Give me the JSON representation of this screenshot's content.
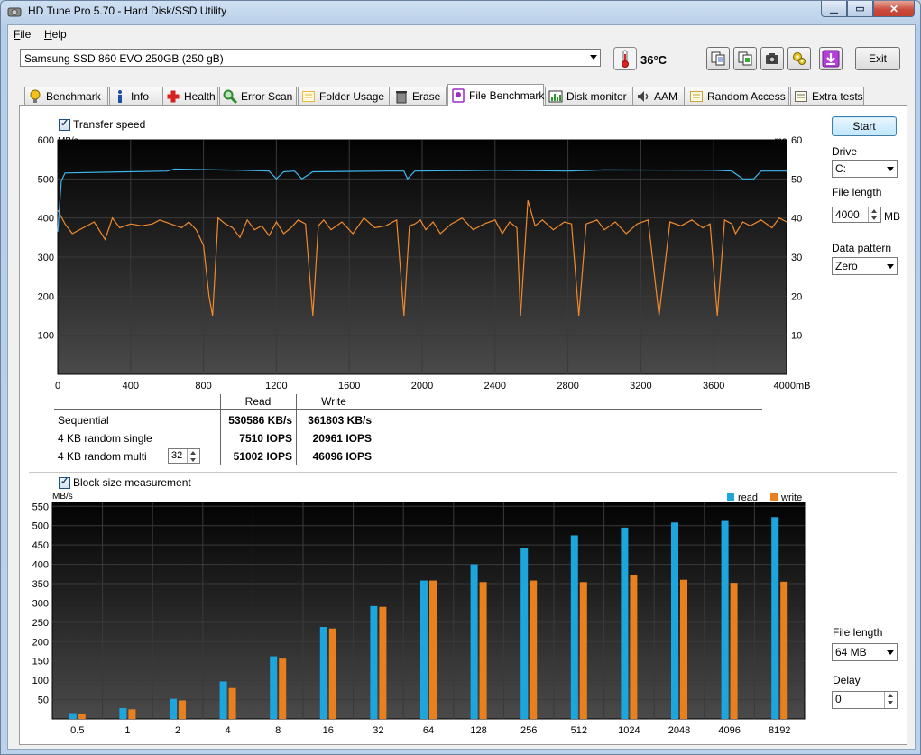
{
  "window": {
    "title": "HD Tune Pro 5.70 - Hard Disk/SSD Utility",
    "buttons": [
      "minimize",
      "maximize",
      "close"
    ]
  },
  "menu": {
    "items": [
      "File",
      "Help"
    ]
  },
  "toolbar": {
    "drive": "Samsung SSD 860 EVO 250GB (250 gB)",
    "temperature": "36°C",
    "exit_label": "Exit",
    "icons": [
      "copy-text-icon",
      "copy-info-icon",
      "screenshot-icon",
      "options-icon",
      "save-icon"
    ]
  },
  "tabs": [
    {
      "label": "Benchmark",
      "icon": "bulb-icon"
    },
    {
      "label": "Info",
      "icon": "info-icon"
    },
    {
      "label": "Health",
      "icon": "health-icon"
    },
    {
      "label": "Error Scan",
      "icon": "magnifier-icon"
    },
    {
      "label": "Folder Usage",
      "icon": "folder-icon"
    },
    {
      "label": "Erase",
      "icon": "trash-icon"
    },
    {
      "label": "File Benchmark",
      "icon": "file-benchmark-icon",
      "active": true
    },
    {
      "label": "Disk monitor",
      "icon": "monitor-icon"
    },
    {
      "label": "AAM",
      "icon": "speaker-icon"
    },
    {
      "label": "Random Access",
      "icon": "random-icon"
    },
    {
      "label": "Extra tests",
      "icon": "extra-icon"
    }
  ],
  "controls": {
    "start_label": "Start",
    "drive_label": "Drive",
    "drive_value": "C:",
    "file_length_label": "File length",
    "file_length_value": "4000",
    "file_length_unit": "MB",
    "data_pattern_label": "Data pattern",
    "data_pattern_value": "Zero",
    "bs_file_length_label": "File length",
    "bs_file_length_value": "64 MB",
    "delay_label": "Delay",
    "delay_value": "0"
  },
  "transfer": {
    "checkbox_label": "Transfer speed",
    "checked": true,
    "y_left_unit": "MB/s",
    "y_right_unit": "ms",
    "x_unit": "mB",
    "y_left_ticks": [
      "600",
      "500",
      "400",
      "300",
      "200",
      "100"
    ],
    "y_right_ticks": [
      "60",
      "50",
      "40",
      "30",
      "20",
      "10"
    ],
    "x_ticks": [
      "0",
      "400",
      "800",
      "1200",
      "1600",
      "2000",
      "2400",
      "2800",
      "3200",
      "3600",
      "4000"
    ]
  },
  "results": {
    "headers": [
      "Read",
      "Write"
    ],
    "rows": [
      {
        "label": "Sequential",
        "read": "530586 KB/s",
        "write": "361803 KB/s"
      },
      {
        "label": "4 KB random single",
        "read": "7510 IOPS",
        "write": "20961 IOPS"
      },
      {
        "label": "4 KB random multi",
        "read": "51002 IOPS",
        "write": "46096 IOPS",
        "queue": "32"
      }
    ]
  },
  "blocksize": {
    "checkbox_label": "Block size measurement",
    "checked": true,
    "y_unit": "MB/s",
    "legend": [
      "read",
      "write"
    ]
  },
  "colors": {
    "read_line": "#3fb6ef",
    "write_line": "#f08a2c",
    "read_bar": "#1da6de",
    "write_bar": "#e8801e"
  },
  "chart_data": [
    {
      "type": "line",
      "title": "",
      "xlabel": "mB",
      "ylabel": "MB/s",
      "xlim": [
        0,
        4000
      ],
      "ylim": [
        0,
        600
      ],
      "y2lim": [
        0,
        60
      ],
      "series": [
        {
          "name": "Read",
          "x": [
            0,
            20,
            40,
            600,
            640,
            1000,
            1160,
            1200,
            1240,
            1300,
            1340,
            1400,
            1800,
            1900,
            1920,
            1960,
            2400,
            2800,
            3000,
            3600,
            3700,
            3760,
            3820,
            3860,
            4000
          ],
          "values": [
            365,
            495,
            515,
            520,
            525,
            522,
            520,
            500,
            518,
            520,
            500,
            518,
            520,
            520,
            500,
            520,
            522,
            520,
            523,
            522,
            520,
            500,
            500,
            520,
            520
          ]
        },
        {
          "name": "Write",
          "x": [
            0,
            40,
            80,
            140,
            200,
            260,
            300,
            340,
            400,
            460,
            520,
            560,
            620,
            680,
            720,
            760,
            800,
            830,
            850,
            880,
            920,
            960,
            1000,
            1040,
            1080,
            1120,
            1160,
            1200,
            1240,
            1280,
            1320,
            1360,
            1400,
            1430,
            1460,
            1500,
            1560,
            1620,
            1680,
            1740,
            1800,
            1860,
            1900,
            1930,
            1960,
            1990,
            2020,
            2060,
            2100,
            2160,
            2220,
            2280,
            2340,
            2400,
            2440,
            2480,
            2520,
            2540,
            2580,
            2620,
            2660,
            2720,
            2780,
            2820,
            2860,
            2900,
            2960,
            3000,
            3060,
            3120,
            3180,
            3240,
            3300,
            3360,
            3420,
            3480,
            3540,
            3580,
            3620,
            3660,
            3700,
            3720,
            3760,
            3800,
            3860,
            3920,
            3960,
            4000
          ],
          "values": [
            420,
            385,
            360,
            375,
            390,
            345,
            400,
            375,
            385,
            380,
            385,
            395,
            385,
            375,
            390,
            370,
            330,
            200,
            150,
            400,
            385,
            375,
            350,
            395,
            370,
            380,
            355,
            390,
            360,
            375,
            395,
            385,
            150,
            380,
            395,
            370,
            390,
            360,
            400,
            375,
            380,
            395,
            150,
            380,
            385,
            395,
            370,
            390,
            360,
            385,
            400,
            370,
            385,
            395,
            360,
            390,
            375,
            150,
            445,
            380,
            395,
            370,
            390,
            385,
            150,
            385,
            395,
            370,
            390,
            360,
            385,
            395,
            150,
            390,
            380,
            395,
            375,
            385,
            150,
            395,
            385,
            360,
            390,
            380,
            395,
            375,
            400,
            390
          ]
        }
      ]
    },
    {
      "type": "bar",
      "title": "",
      "xlabel": "",
      "ylabel": "MB/s",
      "ylim": [
        0,
        560
      ],
      "yticks": [
        50,
        100,
        150,
        200,
        250,
        300,
        350,
        400,
        450,
        500,
        550
      ],
      "categories": [
        "0.5",
        "1",
        "2",
        "4",
        "8",
        "16",
        "32",
        "64",
        "128",
        "256",
        "512",
        "1024",
        "2048",
        "4096",
        "8192"
      ],
      "series": [
        {
          "name": "read",
          "values": [
            15,
            28,
            52,
            97,
            162,
            238,
            292,
            358,
            400,
            443,
            475,
            495,
            508,
            512,
            522
          ]
        },
        {
          "name": "write",
          "values": [
            14,
            25,
            48,
            80,
            156,
            234,
            290,
            358,
            354,
            358,
            354,
            372,
            360,
            352,
            355
          ]
        }
      ]
    }
  ]
}
